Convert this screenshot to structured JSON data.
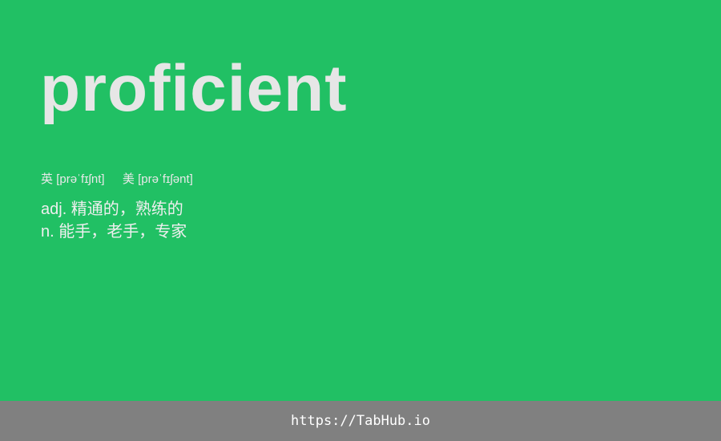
{
  "card": {
    "word": "proficient",
    "phonetics": {
      "uk_label": "英",
      "uk_ipa": "[prəˈfɪʃnt]",
      "us_label": "美",
      "us_ipa": "[prəˈfɪʃənt]"
    },
    "definitions": [
      "adj. 精通的，熟练的",
      "n. 能手，老手，专家"
    ]
  },
  "footer": {
    "link_text": "https://TabHub.io"
  },
  "colors": {
    "background": "#21c064",
    "footer_background": "#808080",
    "text": "#e6e6e6"
  }
}
